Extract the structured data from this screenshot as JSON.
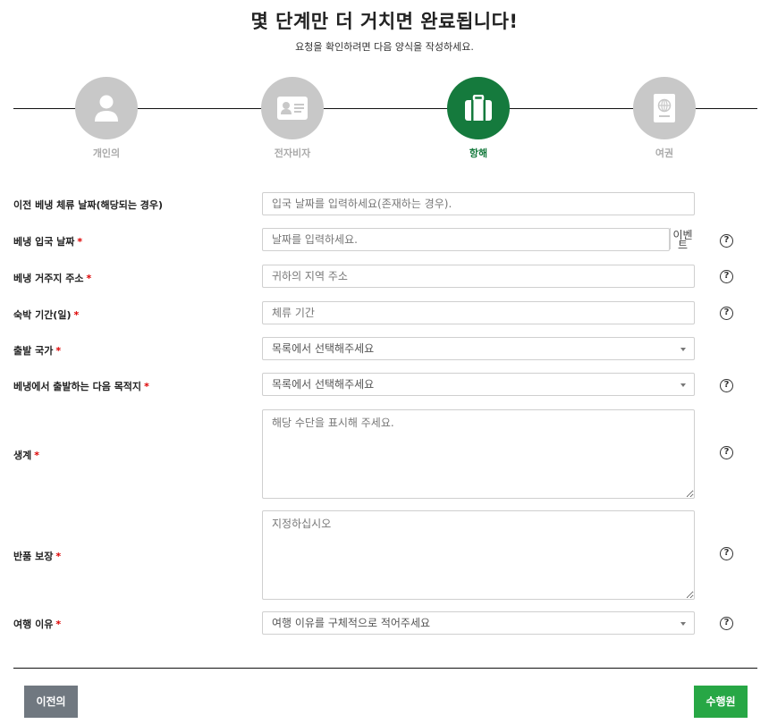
{
  "header": {
    "title": "몇 단계만 더 거치면 완료됩니다!",
    "subtitle": "요청을 확인하려면 다음 양식을 작성하세요."
  },
  "steps": [
    {
      "label": "개인의",
      "icon": "person-icon",
      "active": false
    },
    {
      "label": "전자비자",
      "icon": "id-card-icon",
      "active": false
    },
    {
      "label": "항해",
      "icon": "luggage-icon",
      "active": true
    },
    {
      "label": "여권",
      "icon": "passport-icon",
      "active": false
    }
  ],
  "form": {
    "prev_stay": {
      "label": "이전 베냉 체류 날짜(해당되는 경우)",
      "placeholder": "입국 날짜를 입력하세요(존재하는 경우)."
    },
    "entry_date": {
      "label": "베냉 입국 날짜",
      "placeholder": "날짜를 입력하세요.",
      "addon": "이벤트"
    },
    "address": {
      "label": "베냉 거주지 주소",
      "placeholder": "귀하의 지역 주소"
    },
    "stay_length": {
      "label": "숙박 기간(일)",
      "placeholder": "체류 기간"
    },
    "departure_country": {
      "label": "출발 국가",
      "value": "목록에서 선택해주세요"
    },
    "next_destination": {
      "label": "베냉에서 출발하는 다음 목적지",
      "value": "목록에서 선택해주세요"
    },
    "livelihood": {
      "label": "생계",
      "placeholder": "해당 수단을 표시해 주세요."
    },
    "return_guarantee": {
      "label": "반품 보장",
      "placeholder": "지정하십시오"
    },
    "travel_reason": {
      "label": "여행 이유",
      "value": "여행 이유를 구체적으로 적어주세요"
    }
  },
  "required_mark": "*",
  "help_glyph": "?",
  "buttons": {
    "prev": "이전의",
    "next": "수행원"
  },
  "colors": {
    "accent": "#157a3d",
    "next_button": "#27a745",
    "prev_button": "#707880",
    "required": "#dd0000"
  }
}
